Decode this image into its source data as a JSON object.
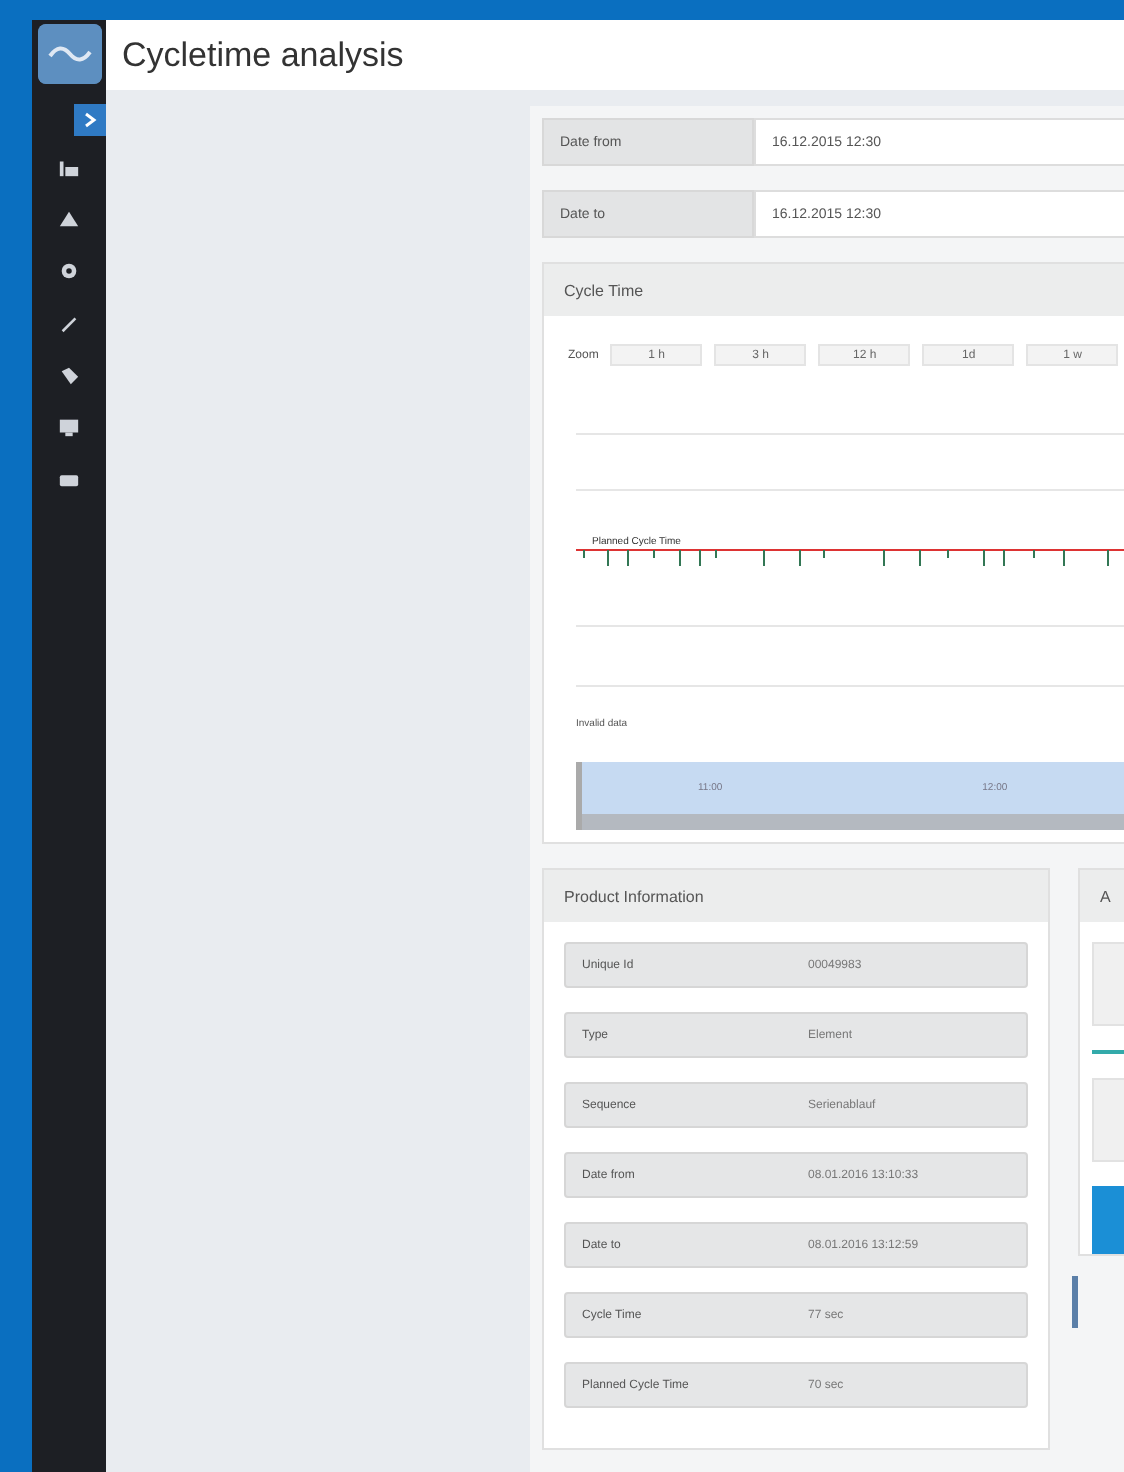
{
  "header": {
    "title": "Cycletime analysis"
  },
  "filters": [
    {
      "label": "Date from",
      "value": "16.12.2015 12:30"
    },
    {
      "label": "Date to",
      "value": "16.12.2015 12:30"
    }
  ],
  "cycle_time": {
    "title": "Cycle Time",
    "zoom_label": "Zoom",
    "zoom_buttons": [
      "1 h",
      "3 h",
      "12 h",
      "1d",
      "1 w"
    ],
    "planned_label": "Planned Cycle Time",
    "invalid_label": "Invalid data",
    "navigator_labels": [
      "11:00",
      "12:00"
    ]
  },
  "product_information": {
    "title": "Product Information",
    "rows": [
      {
        "label": "Unique Id",
        "value": "00049983"
      },
      {
        "label": "Type",
        "value": "Element"
      },
      {
        "label": "Sequence",
        "value": "Serienablauf"
      },
      {
        "label": "Date from",
        "value": "08.01.2016 13:10:33"
      },
      {
        "label": "Date to",
        "value": "08.01.2016 13:12:59"
      },
      {
        "label": "Cycle Time",
        "value": "77 sec"
      },
      {
        "label": "Planned Cycle Time",
        "value": "70 sec"
      }
    ]
  },
  "side_panel": {
    "title": "A"
  }
}
